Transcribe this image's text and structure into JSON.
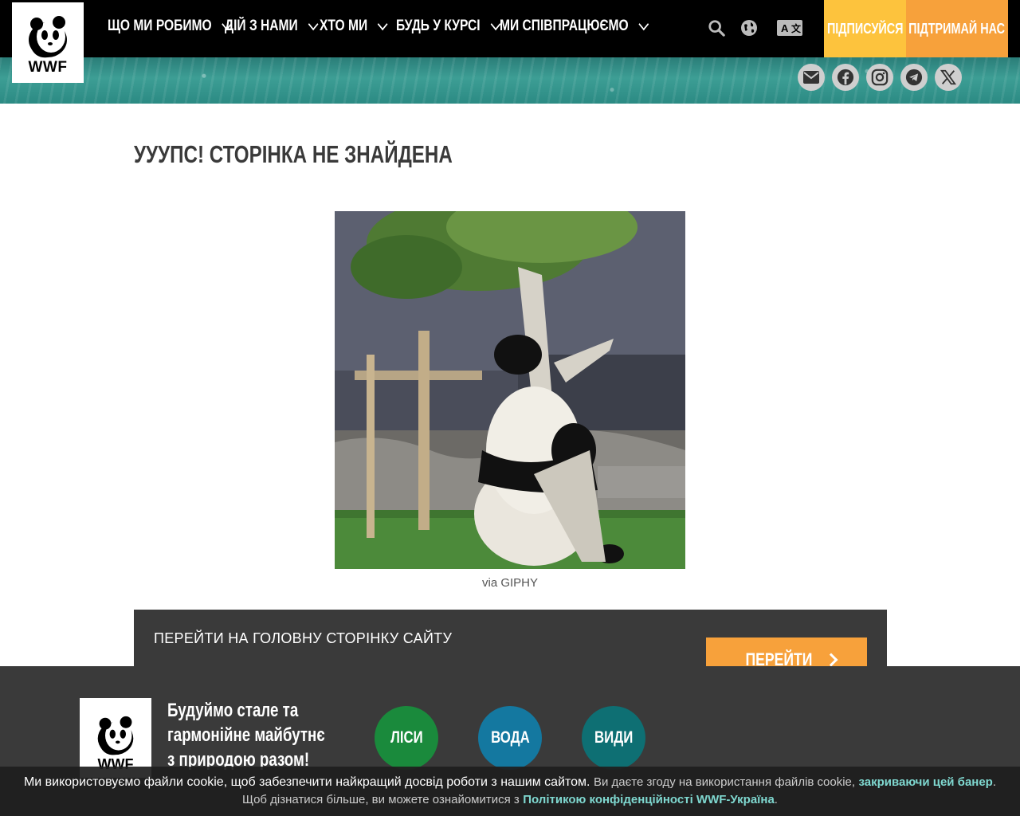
{
  "header": {
    "logo_text": "WWF",
    "nav": [
      {
        "label": "ЩО МИ РОБИМО"
      },
      {
        "label": "ДІЙ З НАМИ"
      },
      {
        "label": "ХТО МИ"
      },
      {
        "label": "БУДЬ У КУРСІ"
      },
      {
        "label": "МИ СПІВПРАЦЮЄМО"
      }
    ],
    "icons": [
      "search-icon",
      "globe-icon",
      "translate-icon"
    ],
    "subscribe_label": "ПІДПИСУЙСЯ",
    "support_label": "ПІДТРИМАЙ НАС",
    "colors": {
      "subscribe": "#fdc33d",
      "support": "#f7a13b"
    }
  },
  "social": [
    "email-icon",
    "facebook-icon",
    "instagram-icon",
    "telegram-icon",
    "x-icon"
  ],
  "main": {
    "title": "УУУПС! СТОРІНКА НЕ ЗНАЙДЕНА",
    "caption": "via GIPHY",
    "home_prompt": "ПЕРЕЙТИ НА ГОЛОВНУ СТОРІНКУ САЙТУ",
    "go_label": "ПЕРЕЙТИ"
  },
  "footer": {
    "logo_text": "WWF",
    "slogan": "Будуймо стале та гармонійне майбутнє з природою разом!",
    "circles": [
      {
        "label": "ЛІСИ",
        "color": "#1a8a3c"
      },
      {
        "label": "ВОДА",
        "color": "#1478a0"
      },
      {
        "label": "ВИДИ",
        "color": "#0e6f73"
      }
    ]
  },
  "cookie": {
    "text_main": "Ми використовуємо файли cookie, щоб забезпечити найкращий досвід роботи з нашим сайтом.",
    "text_consent": "Ви даєте згоду на використання файлів cookie,",
    "link_close": "закриваючи цей банер",
    "text_more": "Щоб дізнатися більше, ви можете ознайомитися з",
    "link_privacy": "Політикою конфіденційності WWF-Україна"
  }
}
